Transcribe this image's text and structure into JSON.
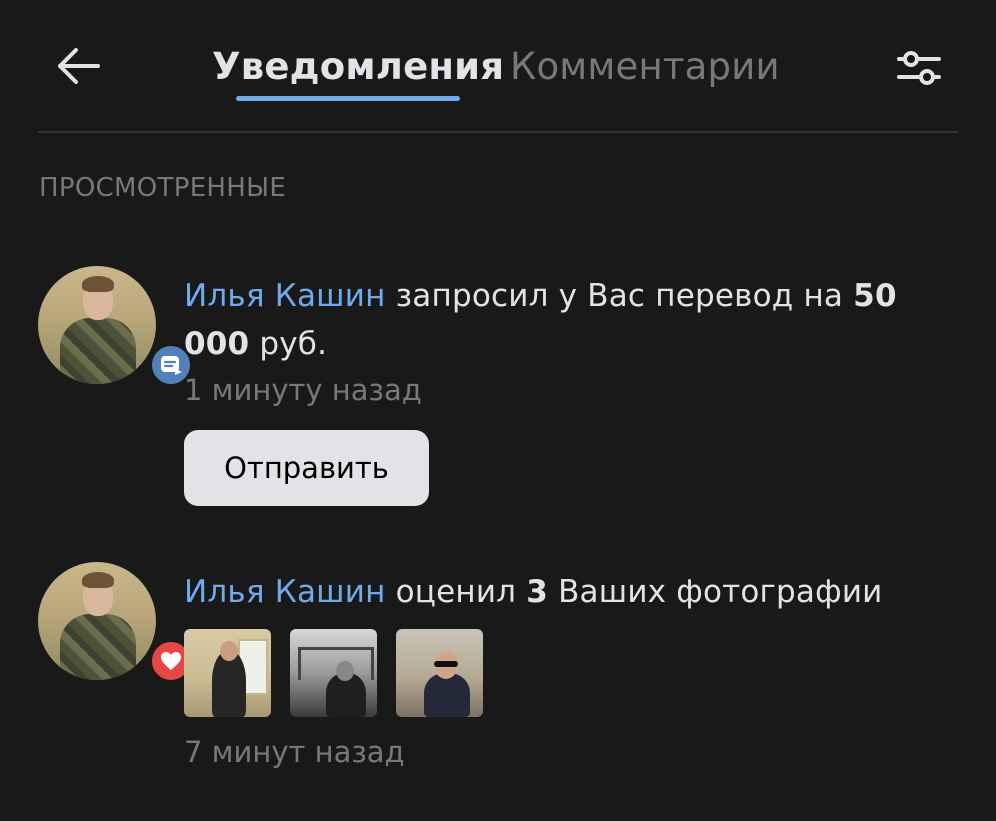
{
  "header": {
    "back_icon": "arrow-left-icon",
    "tabs": [
      {
        "label": "Уведомления",
        "active": true
      },
      {
        "label": "Комментарии",
        "active": false
      }
    ],
    "filter_icon": "sliders-icon"
  },
  "section": {
    "title": "ПРОСМОТРЕННЫЕ"
  },
  "notifications": [
    {
      "badge_icon": "money-transfer-icon",
      "user": "Илья Кашин",
      "text_before_amount": " запросил у Вас перевод на ",
      "amount": "50 000",
      "text_after_amount": " руб.",
      "time": "1 минуту назад",
      "action_label": "Отправить"
    },
    {
      "badge_icon": "heart-icon",
      "user": "Илья Кашин",
      "text_before_count": " оценил ",
      "count": "3",
      "text_after_count": " Ваших фотографии",
      "time": "7 минут назад",
      "photos": [
        "photo-1",
        "photo-2",
        "photo-3"
      ]
    }
  ],
  "colors": {
    "background": "#19191a",
    "accent": "#71aaeb",
    "text_primary": "#e1e3e6",
    "text_secondary": "#76787a",
    "badge_transfer": "#5181b8",
    "badge_like": "#e64646"
  }
}
